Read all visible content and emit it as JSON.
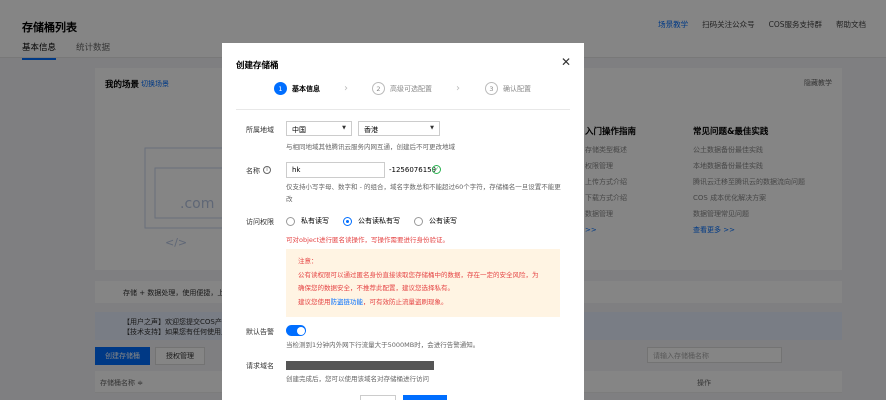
{
  "page": {
    "title": "存储桶列表",
    "tabs": [
      "基本信息",
      "统计数据"
    ],
    "header_links": [
      "场景教学",
      "扫码关注公众号",
      "COS服务支持群",
      "帮助文档"
    ]
  },
  "scene": {
    "title": "我的场景",
    "switch_label": "切换场景",
    "hide_label": "隐藏教学",
    "col1_title": "入门操作指南",
    "col1_items": [
      "存储类型概述",
      "权限管理",
      "上传方式介绍",
      "下载方式介绍",
      "数据管理"
    ],
    "col2_title": "常见问题&最佳实践",
    "col2_items": [
      "公土数据备份最佳实践",
      "本地数据备份最佳实践",
      "腾讯云迁移至腾讯云的数据流向问题",
      "COS 成本优化解决方案",
      "数据管理常见问题"
    ],
    "col2_more": "查看更多 >>",
    "col1_more": ">>"
  },
  "notice1": "存储 + 数据处理，使用便捷，上线",
  "notice2": [
    "【用户之声】欢迎您提交COS产品反馈",
    "【技术支持】如果您有任何使用上的"
  ],
  "toolbar": {
    "create_label": "创建存储桶",
    "auth_label": "授权管理",
    "search_placeholder": "请输入存储桶名称"
  },
  "table": {
    "col_name": "存储桶名称 ≑",
    "col_ops": "操作"
  },
  "modal": {
    "title": "创建存储桶",
    "close": "✕",
    "steps": [
      {
        "num": "1",
        "label": "基本信息"
      },
      {
        "num": "2",
        "label": "高级可选配置"
      },
      {
        "num": "3",
        "label": "确认配置"
      }
    ],
    "region": {
      "label": "所属地域",
      "country": "中国",
      "city": "香港",
      "hint": "与相同地域其他腾讯云服务内网互通，创建后不可更改地域"
    },
    "name": {
      "label": "名称",
      "value": "hk",
      "suffix": "-1256076159",
      "hint_line1": "仅支持小写字母、数字和 - 的组合，域名字数总和不能超过60个字符，存储桶名一旦设置不能更",
      "hint_line2": "改"
    },
    "access": {
      "label": "访问权限",
      "options": [
        "私有读写",
        "公有读私有写",
        "公有读写"
      ],
      "selected_index": 1,
      "warning": "可对object进行匿名读操作，写操作需要进行身份验证。",
      "notice_title": "注意：",
      "notice_line1": "公有读权限可以通过匿名身份直接读取您存储桶中的数据，存在一定的安全风险，为",
      "notice_line2": "确保您的数据安全，不推荐此配置，建议您选择私有。",
      "notice_line3_pre": "建议您使用",
      "notice_link": "防盗链功能",
      "notice_line3_post": "，可有效防止流量盗刷现象。"
    },
    "alarm": {
      "label": "默认告警",
      "enabled": true,
      "hint": "当检测到1分钟内外网下行流量大于5000MB时，会进行告警通知。"
    },
    "domain": {
      "label": "请求域名",
      "hint": "创建完成后，您可以使用该域名对存储桶进行访问"
    }
  }
}
